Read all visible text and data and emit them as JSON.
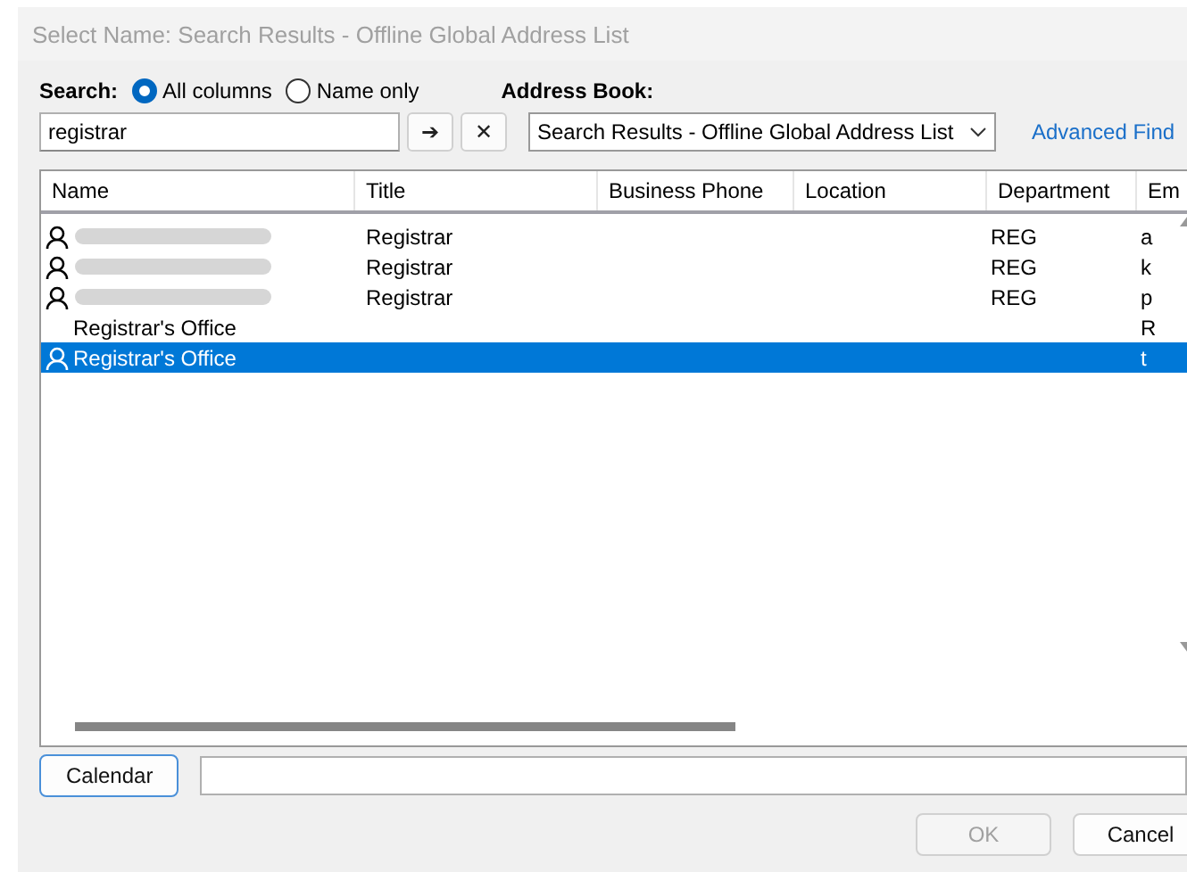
{
  "window": {
    "title": "Select Name: Search Results - Offline Global Address List"
  },
  "search": {
    "label": "Search:",
    "options": [
      {
        "label": "All columns",
        "selected": true
      },
      {
        "label": "Name only",
        "selected": false
      }
    ],
    "value": "registrar",
    "go_button": "➔",
    "clear_button": "✕"
  },
  "address_book": {
    "label": "Address Book:",
    "value": "Search Results - Offline Global Address List",
    "advanced_find": "Advanced Find"
  },
  "table": {
    "columns": [
      "Name",
      "Title",
      "Business Phone",
      "Location",
      "Department",
      "Em"
    ],
    "rows": [
      {
        "kind": "person",
        "name_redacted": true,
        "title": "Registrar",
        "department": "REG",
        "column_6": "a",
        "selected": false
      },
      {
        "kind": "person",
        "name_redacted": true,
        "title": "Registrar",
        "department": "REG",
        "column_6": "k",
        "selected": false
      },
      {
        "kind": "person",
        "name_redacted": true,
        "title": "Registrar",
        "department": "REG",
        "column_6": "p",
        "selected": false
      },
      {
        "kind": "group",
        "name_redacted": false,
        "name": "Registrar's Office",
        "column_6": "R",
        "selected": false
      },
      {
        "kind": "person",
        "name_redacted": false,
        "name": "Registrar's Office",
        "column_6": "t",
        "selected": true
      }
    ]
  },
  "calendar_button": "Calendar",
  "buttons": [
    {
      "label": "OK",
      "disabled": true
    },
    {
      "label": "Cancel",
      "disabled": false
    }
  ]
}
